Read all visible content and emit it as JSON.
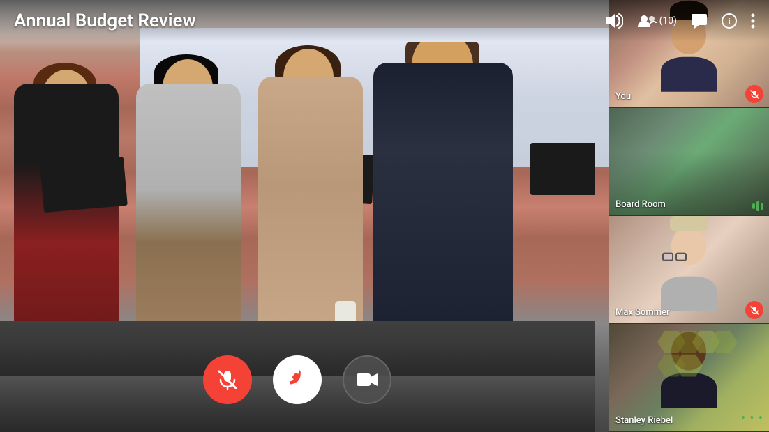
{
  "header": {
    "title": "Annual Budget Review",
    "participants_count": "(10)",
    "icons": {
      "volume": "🔊",
      "participants": "👥",
      "chat": "💬",
      "info": "ℹ",
      "more": "⋮"
    }
  },
  "controls": {
    "mute_label": "mute",
    "hangup_label": "hangup",
    "camera_label": "camera",
    "mute_icon": "🎤",
    "hangup_icon": "📞",
    "camera_icon": "📹"
  },
  "sidebar": {
    "tiles": [
      {
        "id": "you",
        "label": "You",
        "has_mute": true,
        "has_audio": false
      },
      {
        "id": "boardroom",
        "label": "Board Room",
        "has_mute": false,
        "has_audio": true
      },
      {
        "id": "max",
        "label": "Max Sommer",
        "has_mute": true,
        "has_audio": false
      },
      {
        "id": "stanley",
        "label": "Stanley Riebel",
        "has_mute": false,
        "has_audio": false,
        "has_dots": true
      }
    ]
  },
  "colors": {
    "accent_red": "#f44336",
    "accent_green": "#4CAF50",
    "bg_dark": "#1a1a1a",
    "control_dark": "#555555",
    "control_white": "#ffffff"
  }
}
